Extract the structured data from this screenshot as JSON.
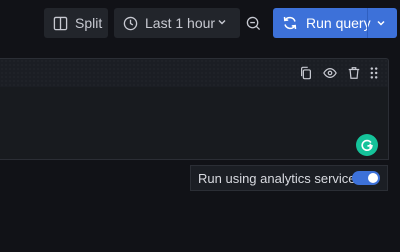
{
  "toolbar": {
    "split_label": "Split",
    "time_range_label": "Last 1 hour",
    "run_query_label": "Run query"
  },
  "query_row": {
    "actions": [
      "copy-icon",
      "eye-icon",
      "trash-icon",
      "drag-handle-icon"
    ]
  },
  "analytics": {
    "label": "Run using analytics service",
    "enabled": true
  },
  "colors": {
    "background": "#111217",
    "panel": "#1b1e24",
    "accent": "#3d71d9",
    "grammarly": "#15c39a"
  }
}
